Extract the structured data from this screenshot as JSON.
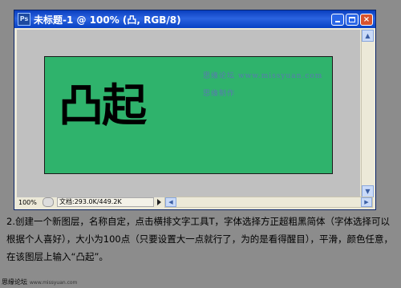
{
  "window": {
    "title": "未标题-1 @ 100% (凸, RGB/8)",
    "app_icon_label": "Ps",
    "minimize_label": "",
    "maximize_label": "",
    "close_label": "×"
  },
  "canvas": {
    "text": "凸起",
    "background_color": "#2fb36c",
    "watermark_line1": "思缘论坛 www.missyuan.com",
    "watermark_line2": "思缘制作"
  },
  "statusbar": {
    "zoom": "100%",
    "doc_info": "文档:293.0K/449.2K"
  },
  "instruction": "2.创建一个新图层，名称自定，点击横排文字工具T，字体选择方正超粗黑简体（字体选择可以根据个人喜好），大小为100点（只要设置大一点就行了，为的是看得醒目），平滑，颜色任意，在该图层上输入“凸起”。",
  "footer": {
    "brand": "思缘论坛",
    "url": "www.missyuan.com"
  }
}
